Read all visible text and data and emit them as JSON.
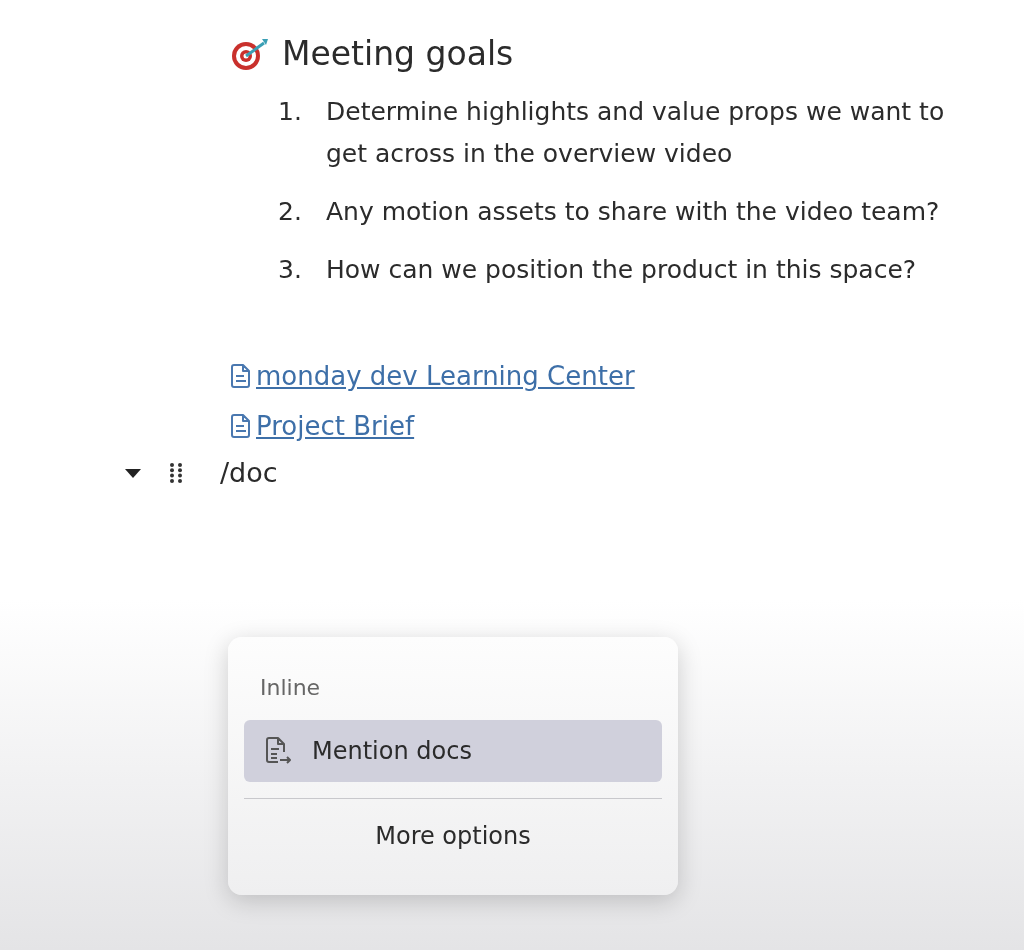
{
  "heading": {
    "title": "Meeting goals"
  },
  "goals": [
    {
      "number": "1.",
      "text": "Determine highlights and value props we want to get across in the overview video"
    },
    {
      "number": "2.",
      "text": "Any motion assets to share with the video team?"
    },
    {
      "number": "3.",
      "text": "How can we position the product in this space?"
    }
  ],
  "doc_links": [
    {
      "label": "monday dev Learning Center"
    },
    {
      "label": "Project Brief"
    }
  ],
  "command_block": {
    "expanded": true,
    "text": "/doc"
  },
  "popup": {
    "section": "Inline",
    "items": [
      {
        "label": "Mention docs",
        "selected": true
      }
    ],
    "more": "More options"
  }
}
